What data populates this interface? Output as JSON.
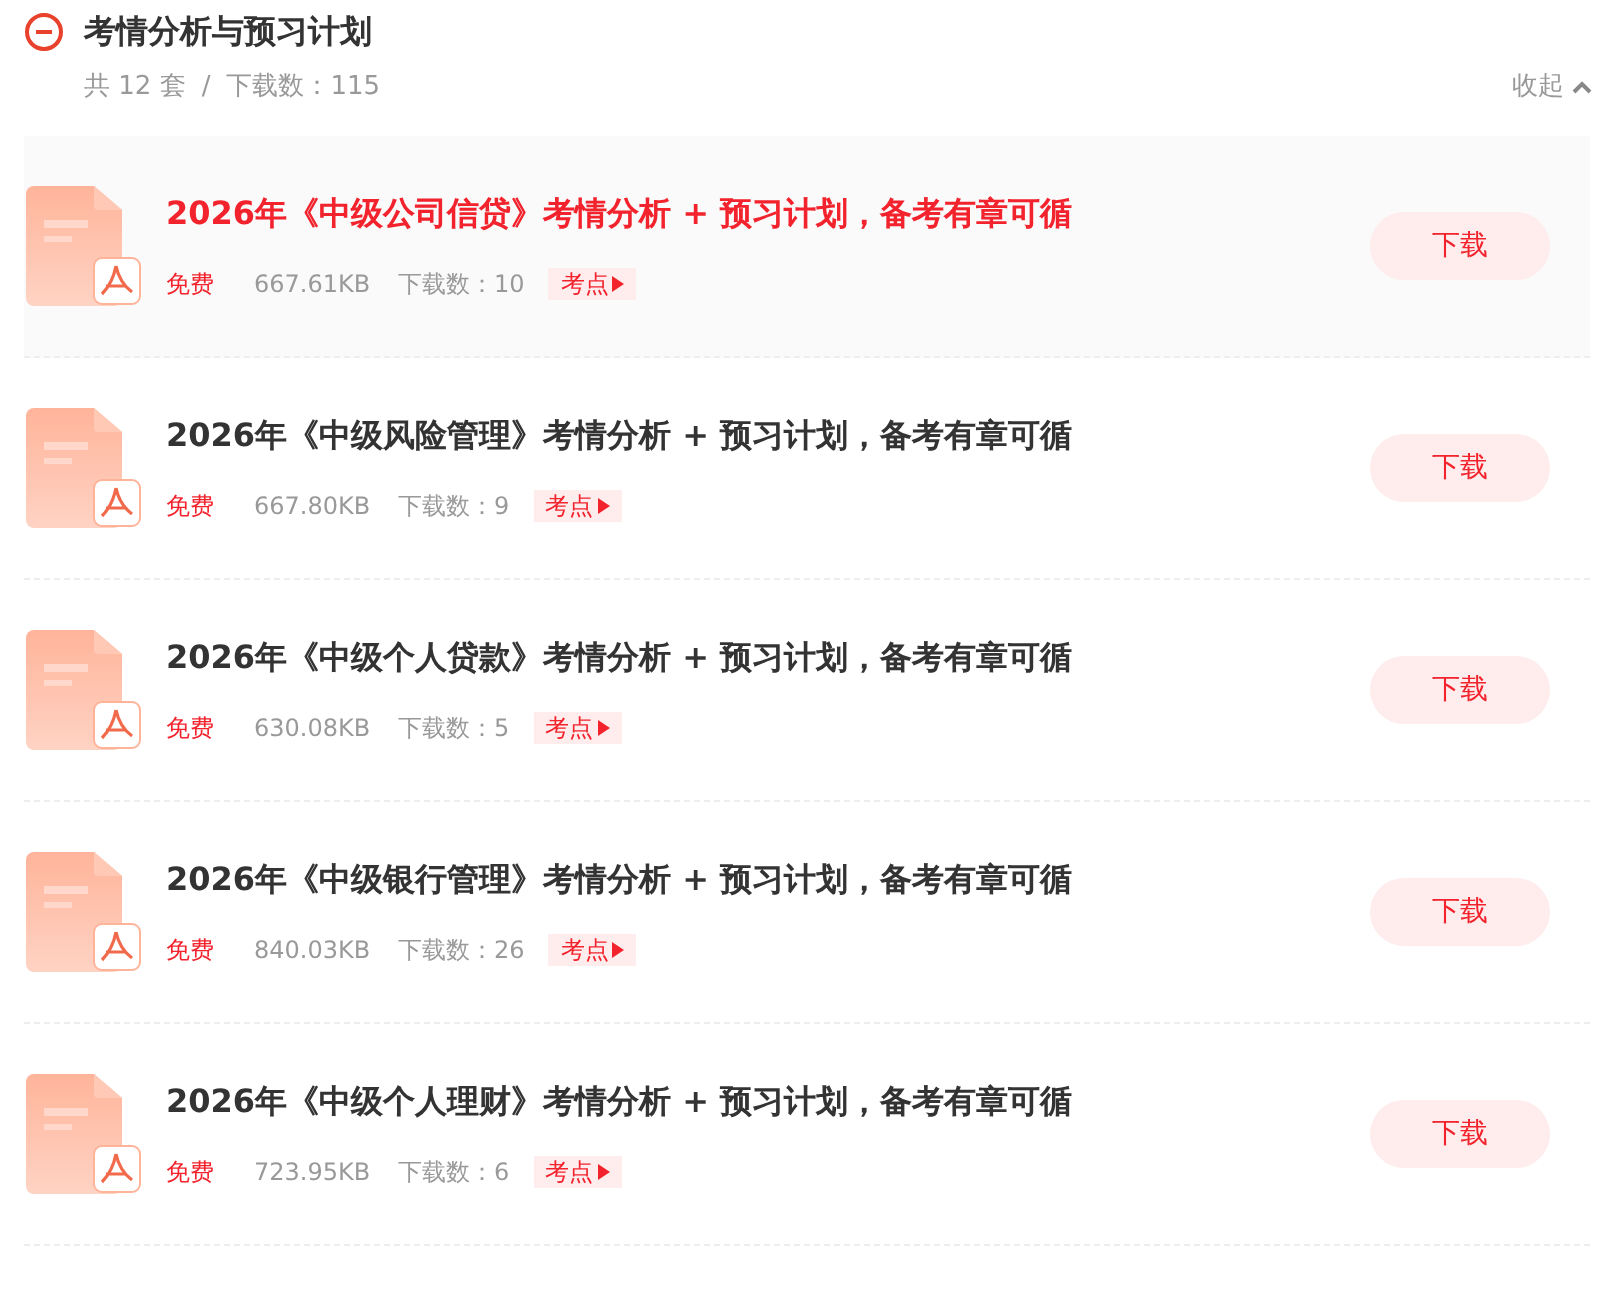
{
  "section": {
    "title": "考情分析与预习计划",
    "expanded": true,
    "count_label": "共 12 套",
    "separator": "/",
    "downloads_label": "下载数：115",
    "collapse_label": "收起"
  },
  "items": [
    {
      "title": "2026年《中级公司信贷》考情分析 + 预习计划，备考有章可循",
      "selected": true,
      "price": "免费",
      "size": "667.61KB",
      "downloads": "下载数：10",
      "tag": "考点",
      "button": "下载"
    },
    {
      "title": "2026年《中级风险管理》考情分析 + 预习计划，备考有章可循",
      "selected": false,
      "price": "免费",
      "size": "667.80KB",
      "downloads": "下载数：9",
      "tag": "考点",
      "button": "下载"
    },
    {
      "title": "2026年《中级个人贷款》考情分析 + 预习计划，备考有章可循",
      "selected": false,
      "price": "免费",
      "size": "630.08KB",
      "downloads": "下载数：5",
      "tag": "考点",
      "button": "下载"
    },
    {
      "title": "2026年《中级银行管理》考情分析 + 预习计划，备考有章可循",
      "selected": false,
      "price": "免费",
      "size": "840.03KB",
      "downloads": "下载数：26",
      "tag": "考点",
      "button": "下载"
    },
    {
      "title": "2026年《中级个人理财》考情分析 + 预习计划，备考有章可循",
      "selected": false,
      "price": "免费",
      "size": "723.95KB",
      "downloads": "下载数：6",
      "tag": "考点",
      "button": "下载"
    }
  ]
}
